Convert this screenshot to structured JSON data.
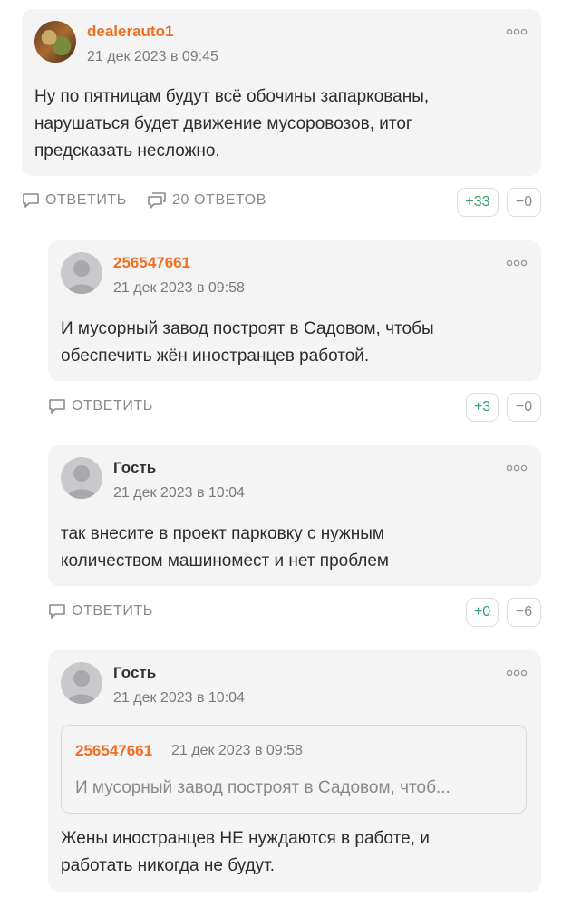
{
  "comments": [
    {
      "author": "dealerauto1",
      "date": "21 дек 2023 в 09:45",
      "lines": [
        "Ну по пятницам будут всё обочины запаркованы,",
        "нарушаться будет движение мусоровозов, итог",
        "предсказать несложно."
      ],
      "reply_label": "ОТВЕТИТЬ",
      "replies_label": "20 ОТВЕТОВ",
      "up": "+33",
      "down": "−0"
    },
    {
      "author": "256547661",
      "date": "21 дек 2023 в 09:58",
      "lines": [
        "И мусорный завод построят в Садовом, чтобы",
        "обеспечить жён иностранцев работой."
      ],
      "reply_label": "ОТВЕТИТЬ",
      "up": "+3",
      "down": "−0"
    },
    {
      "author": "Гость",
      "date": "21 дек 2023 в 10:04",
      "lines": [
        "так внесите в проект парковку с нужным",
        "количеством машиномест и нет проблем"
      ],
      "reply_label": "ОТВЕТИТЬ",
      "up": "+0",
      "down": "−6"
    },
    {
      "author": "Гость",
      "date": "21 дек 2023 в 10:04",
      "quote": {
        "author": "256547661",
        "date": "21 дек 2023 в 09:58",
        "text": "И мусорный завод построят в Садовом, чтоб..."
      },
      "lines": [
        "Жены иностранцев НЕ нуждаются в работе, и",
        "работать никогда не будут."
      ]
    }
  ],
  "colors": {
    "accent": "#f06f22",
    "upvote": "#2fa36b",
    "card": "#f4f4f5"
  },
  "icons": {
    "reply": "speech-bubble-icon",
    "replies": "double-speech-bubble-icon",
    "more": "three-dots-icon"
  }
}
